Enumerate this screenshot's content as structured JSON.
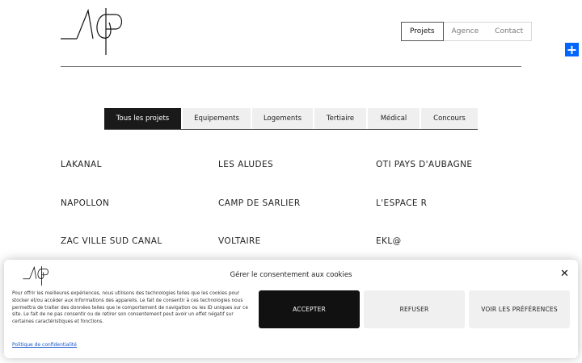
{
  "header": {
    "logo_text": "adp",
    "nav": [
      "Projets",
      "Agence",
      "Contact"
    ],
    "nav_active": 0
  },
  "filters": {
    "tabs": [
      "Tous les projets",
      "Equipements",
      "Logements",
      "Tertiaire",
      "Médical",
      "Concours"
    ],
    "active": 0
  },
  "projects": [
    "LAKANAL",
    "LES ALUDES",
    "OTI PAYS D'AUBAGNE",
    "NAPOLLON",
    "CAMP DE SARLIER",
    "L'ESPACE R",
    "ZAC VILLE SUD CANAL",
    "VOLTAIRE",
    "EKL@"
  ],
  "cookie": {
    "logo_text": "adp",
    "title": "Gérer le consentement aux cookies",
    "close_symbol": "✕",
    "text": "Pour offrir les meilleures expériences, nous utilisons des technologies telles que les cookies pour stocker et/ou accéder aux informations des appareils. Le fait de consentir à ces technologies nous permettra de traiter des données telles que le comportement de navigation ou les ID uniques sur ce site. Le fait de ne pas consentir ou de retirer son consentement peut avoir un effet négatif sur certaines caractéristiques et fonctions.",
    "accept": "ACCEPTER",
    "refuse": "REFUSER",
    "prefs": "VOIR LES PRÉFÉRENCES",
    "policy": "Politique de confidentialité"
  },
  "share_symbol": "+",
  "colors": {
    "accent": "#111111",
    "share": "#0166ff",
    "link": "#1a56c8"
  }
}
